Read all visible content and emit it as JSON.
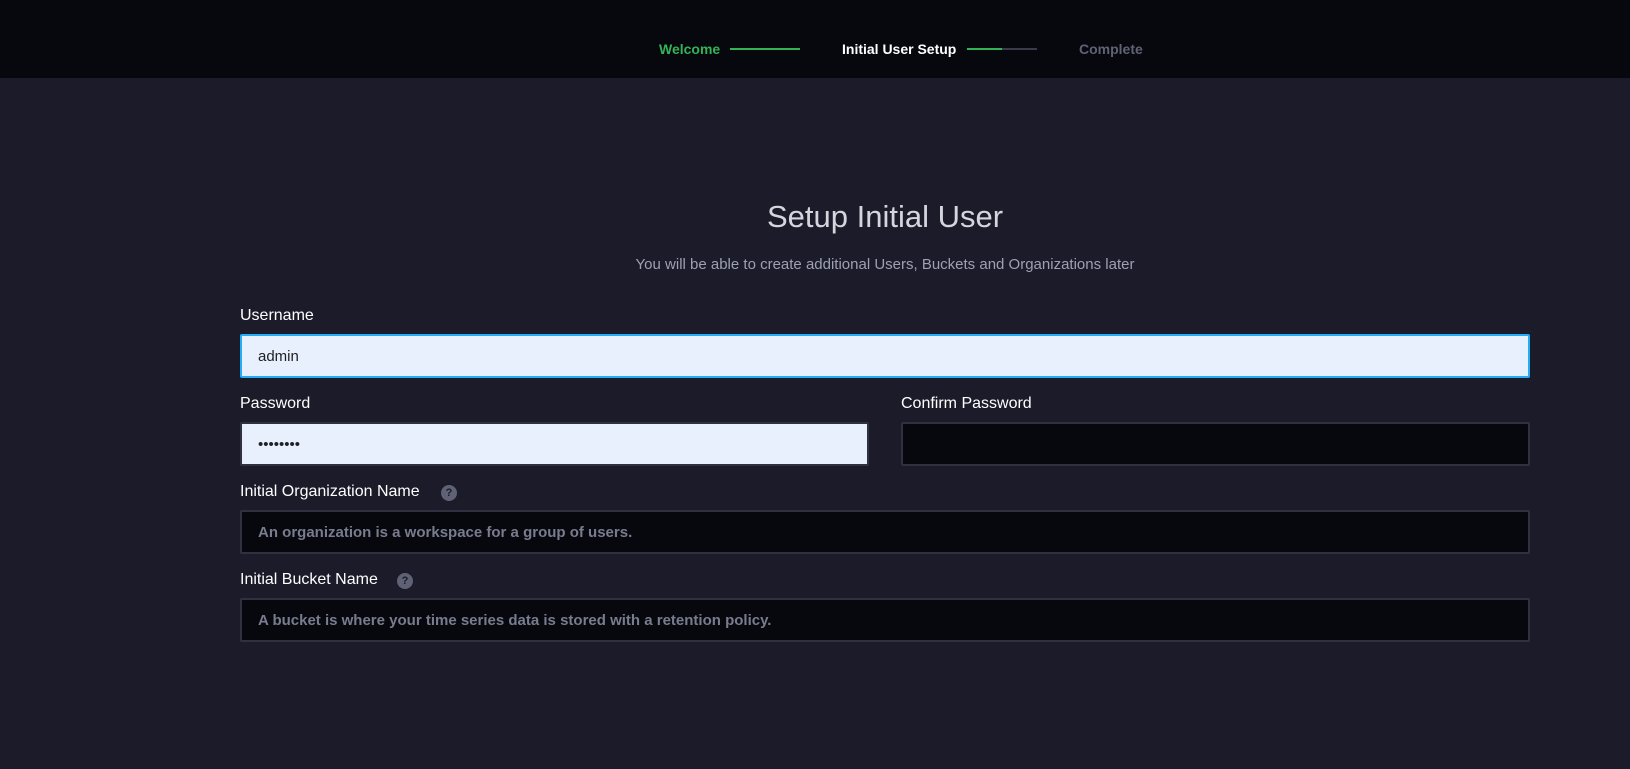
{
  "progress": {
    "steps": [
      {
        "label": "Welcome",
        "state": "done"
      },
      {
        "label": "Initial User Setup",
        "state": "current"
      },
      {
        "label": "Complete",
        "state": "pending"
      }
    ],
    "connector_1_fill": 1.0,
    "connector_2_fill": 0.5
  },
  "form": {
    "title": "Setup Initial User",
    "subtitle": "You will be able to create additional Users, Buckets and Organizations later",
    "username": {
      "label": "Username",
      "value": "admin"
    },
    "password": {
      "label": "Password",
      "value": "••••••••"
    },
    "confirm_password": {
      "label": "Confirm Password",
      "value": ""
    },
    "organization": {
      "label": "Initial Organization Name",
      "placeholder": "An organization is a workspace for a group of users."
    },
    "bucket": {
      "label": "Initial Bucket Name",
      "placeholder": "A bucket is where your time series data is stored with a retention policy."
    }
  },
  "icons": {
    "help": "question-circle-icon"
  },
  "colors": {
    "accent_green": "#34b356",
    "focus_blue": "#22adf6",
    "background": "#1b1b29",
    "topbar": "#07080e"
  }
}
